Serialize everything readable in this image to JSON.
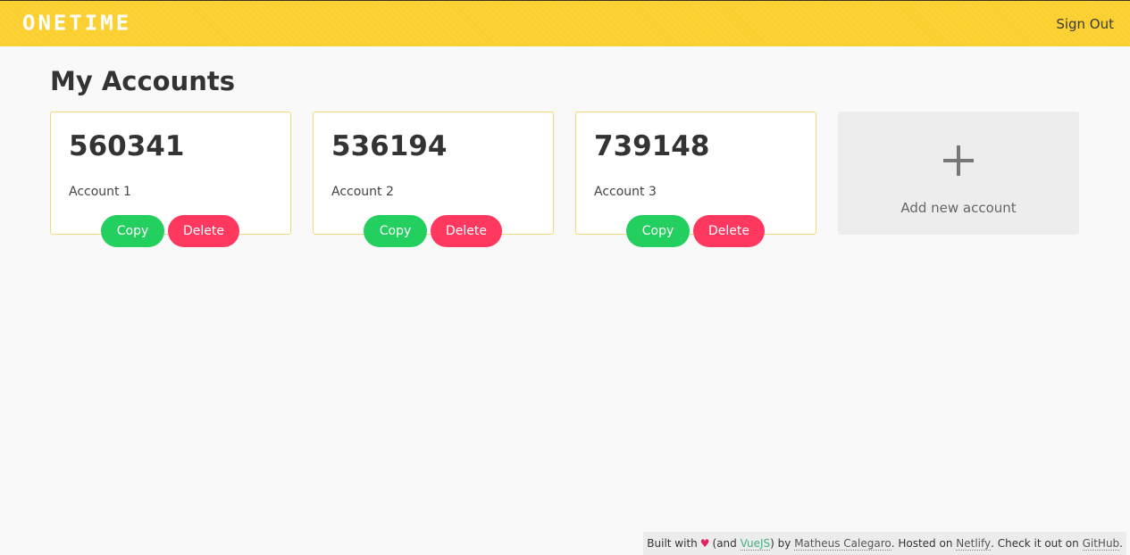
{
  "header": {
    "logo_text": "ONETIME",
    "signout_label": "Sign Out",
    "brand_color": "#fbcf2d"
  },
  "main": {
    "title": "My Accounts",
    "accounts": [
      {
        "code": "560341",
        "name": "Account 1",
        "copy_label": "Copy",
        "delete_label": "Delete"
      },
      {
        "code": "536194",
        "name": "Account 2",
        "copy_label": "Copy",
        "delete_label": "Delete"
      },
      {
        "code": "739148",
        "name": "Account 3",
        "copy_label": "Copy",
        "delete_label": "Delete"
      }
    ],
    "add_card": {
      "icon": "plus-icon",
      "label": "Add new account"
    }
  },
  "footer": {
    "built_with": "Built with",
    "heart": "♥",
    "and_open": "(and",
    "vuejs": "VueJS",
    "by_text": ") by",
    "author": "Matheus Calegaro",
    "hosted_text": ". Hosted on",
    "netlify": "Netlify",
    "check_text": ". Check it out on",
    "github": "GitHub",
    "end": "."
  },
  "colors": {
    "copy": "#23cf5f",
    "delete": "#ff3860",
    "card_border": "#f3d97a"
  }
}
